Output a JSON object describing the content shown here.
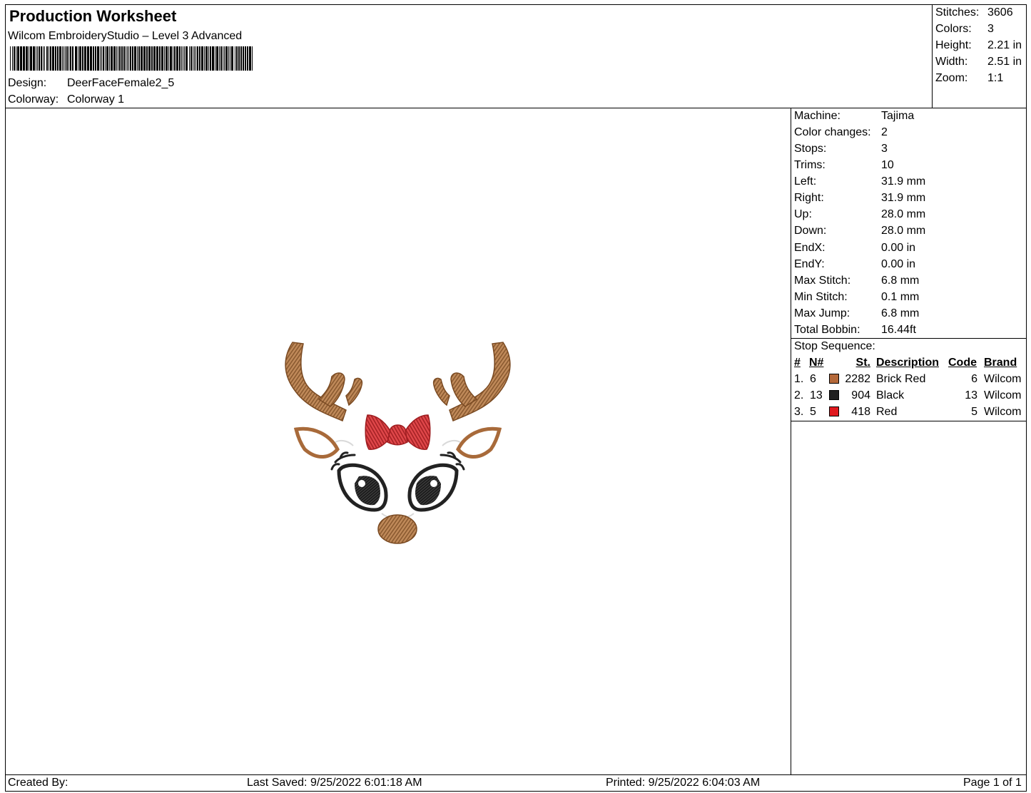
{
  "header": {
    "title": "Production Worksheet",
    "software": "Wilcom EmbroideryStudio – Level 3 Advanced",
    "design_label": "Design:",
    "design_value": "DeerFaceFemale2_5",
    "colorway_label": "Colorway:",
    "colorway_value": "Colorway 1"
  },
  "summary": [
    {
      "label": "Stitches:",
      "value": "3606"
    },
    {
      "label": "Colors:",
      "value": "3"
    },
    {
      "label": "Height:",
      "value": "2.21 in"
    },
    {
      "label": "Width:",
      "value": "2.51 in"
    },
    {
      "label": "Zoom:",
      "value": "1:1"
    }
  ],
  "details": [
    {
      "label": "Machine:",
      "value": "Tajima"
    },
    {
      "label": "Color changes:",
      "value": "2"
    },
    {
      "label": "Stops:",
      "value": "3"
    },
    {
      "label": "Trims:",
      "value": "10"
    },
    {
      "label": "Left:",
      "value": "31.9 mm"
    },
    {
      "label": "Right:",
      "value": "31.9 mm"
    },
    {
      "label": "Up:",
      "value": "28.0 mm"
    },
    {
      "label": "Down:",
      "value": "28.0 mm"
    },
    {
      "label": "EndX:",
      "value": "0.00 in"
    },
    {
      "label": "EndY:",
      "value": "0.00 in"
    },
    {
      "label": "Max Stitch:",
      "value": "6.8 mm"
    },
    {
      "label": "Min Stitch:",
      "value": "0.1 mm"
    },
    {
      "label": "Max Jump:",
      "value": "6.8 mm"
    },
    {
      "label": "Total Bobbin:",
      "value": "16.44ft"
    }
  ],
  "stop_sequence": {
    "title": "Stop Sequence:",
    "headers": {
      "num": "#",
      "n": "N#",
      "st": "St.",
      "description": "Description",
      "code": "Code",
      "brand": "Brand"
    },
    "rows": [
      {
        "num": "1.",
        "n": "6",
        "color": "#b5693a",
        "st": "2282",
        "description": "Brick Red",
        "code": "6",
        "brand": "Wilcom"
      },
      {
        "num": "2.",
        "n": "13",
        "color": "#1f1f1f",
        "st": "904",
        "description": "Black",
        "code": "13",
        "brand": "Wilcom"
      },
      {
        "num": "3.",
        "n": "5",
        "color": "#e0191f",
        "st": "418",
        "description": "Red",
        "code": "5",
        "brand": "Wilcom"
      }
    ]
  },
  "footer": {
    "created_by": "Created By:",
    "last_saved": "Last Saved: 9/25/2022 6:01:18 AM",
    "printed": "Printed: 9/25/2022 6:04:03 AM",
    "page": "Page 1 of 1"
  },
  "design_colors": {
    "antler": "#b07a4c",
    "bow": "#d63a3e",
    "eyes": "#2a2a2a"
  }
}
